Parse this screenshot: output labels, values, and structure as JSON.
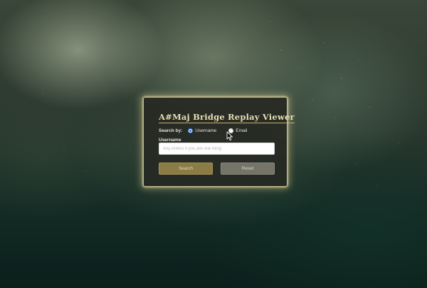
{
  "app": {
    "title": "A#Maj Bridge Replay Viewer"
  },
  "search_by": {
    "label": "Search by:",
    "options": [
      {
        "label": "Username",
        "selected": true
      },
      {
        "label": "Email",
        "selected": false
      }
    ]
  },
  "username_field": {
    "label": "Username",
    "value": "",
    "placeholder": "Any Antero if you are one thing"
  },
  "buttons": {
    "search_label": "Search",
    "reset_label": "Reset"
  },
  "colors": {
    "title_gold": "#e9ddb4",
    "search_button": "#8b7b44",
    "reset_button": "#747468",
    "panel_glow": "#e6d796",
    "radio_accent": "#2f6fd4"
  },
  "icons": {
    "cursor": "mouse-pointer-icon"
  }
}
